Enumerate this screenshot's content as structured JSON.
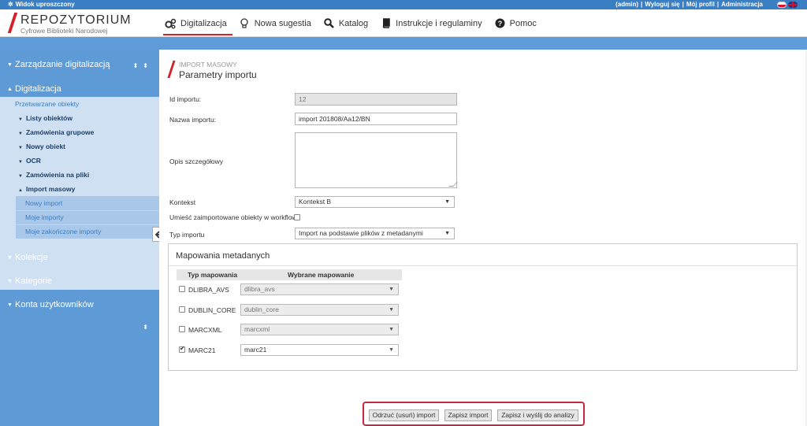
{
  "topbar": {
    "simplified_view": "Widok uproszczony",
    "user": "(admin)",
    "logout": "Wyloguj się",
    "profile": "Mój profil",
    "admin": "Administracja"
  },
  "logo": {
    "title": "REPOZYTORIUM",
    "subtitle": "Cyfrowe Biblioteki Narodowej"
  },
  "nav": [
    {
      "label": "Digitalizacja",
      "icon": "gears-icon",
      "active": true
    },
    {
      "label": "Nowa sugestia",
      "icon": "lightbulb-icon"
    },
    {
      "label": "Katalog",
      "icon": "search-icon"
    },
    {
      "label": "Instrukcje i regulaminy",
      "icon": "book-icon"
    },
    {
      "label": "Pomoc",
      "icon": "question-circle-icon"
    }
  ],
  "sidebar": {
    "zarzadzanie": "Zarządzanie digitalizacją",
    "digitalizacja": "Digitalizacja",
    "przetwarzane": "Przetwarzane obiekty",
    "items": [
      "Listy obiektów",
      "Zamówienia grupowe",
      "Nowy obiekt",
      "OCR",
      "Zamówienia na pliki",
      "Import masowy"
    ],
    "import_sub": [
      "Nowy import",
      "Moje importy",
      "Moje zakończone importy"
    ],
    "kolekcje": "Kolekcje",
    "kategorie": "Kategorie",
    "konta": "Konta użytkowników"
  },
  "heading": {
    "small": "IMPORT MASOWY",
    "title": "Parametry importu"
  },
  "form": {
    "id_label": "Id importu:",
    "id_value": "12",
    "name_label": "Nazwa importu:",
    "name_value": "import 201808/Aa12/BN",
    "desc_label": "Opis szczegółowy",
    "context_label": "Kontekst",
    "context_value": "Kontekst B",
    "workflow_label": "Umieść zaimportowane obiekty w workflow",
    "type_label": "Typ importu",
    "type_value": "Import na podstawie plików z metadanymi"
  },
  "mapping": {
    "title": "Mapowania metadanych",
    "col_type": "Typ mapowania",
    "col_selected": "Wybrane mapowanie",
    "rows": [
      {
        "type": "DLIBRA_AVS",
        "value": "dlibra_avs",
        "checked": false,
        "disabled": true
      },
      {
        "type": "DUBLIN_CORE",
        "value": "dublin_core",
        "checked": false,
        "disabled": true
      },
      {
        "type": "MARCXML",
        "value": "marcxml",
        "checked": false,
        "disabled": true
      },
      {
        "type": "MARC21",
        "value": "marc21",
        "checked": true,
        "disabled": false
      }
    ]
  },
  "buttons": {
    "discard": "Odrzuć (usuń) import",
    "save": "Zapisz import",
    "save_send": "Zapisz i wyślij do analizy"
  },
  "colors": {
    "accent": "#d2232a",
    "topbar": "#3a7ec4",
    "sidebar": "#5e9ad6",
    "highlight_box": "#c8273f"
  }
}
